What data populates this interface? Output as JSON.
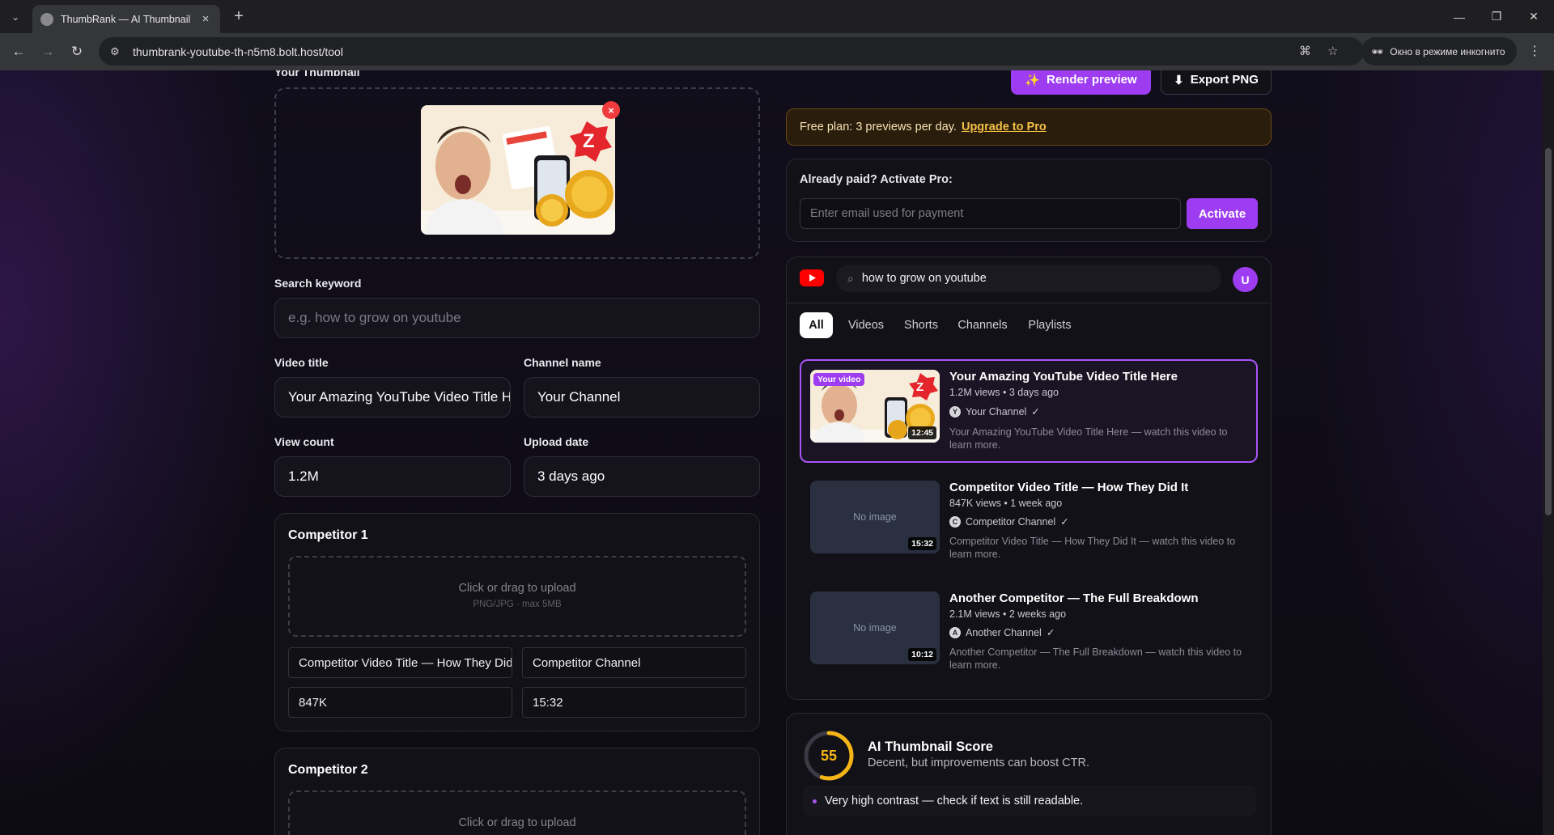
{
  "browser": {
    "tab_title": "ThumbRank — AI Thumbnail Pr",
    "url": "thumbrank-youtube-th-n5m8.bolt.host/tool",
    "incognito_label": "Окно в режиме инкогнито"
  },
  "left": {
    "thumbnail_label": "Your Thumbnail",
    "search_keyword": {
      "label": "Search keyword",
      "placeholder": "e.g. how to grow on youtube"
    },
    "video_title": {
      "label": "Video title",
      "value": "Your Amazing YouTube Video Title Here"
    },
    "channel_name": {
      "label": "Channel name",
      "value": "Your Channel"
    },
    "view_count": {
      "label": "View count",
      "value": "1.2M"
    },
    "upload_date": {
      "label": "Upload date",
      "value": "3 days ago"
    },
    "competitor1": {
      "heading": "Competitor 1",
      "upload_text": "Click or drag to upload",
      "upload_hint": "PNG/JPG · max 5MB",
      "title": "Competitor Video Title — How They Did It",
      "channel": "Competitor Channel",
      "views": "847K",
      "duration": "15:32"
    },
    "competitor2": {
      "heading": "Competitor 2",
      "upload_text": "Click or drag to upload"
    }
  },
  "right": {
    "render_label": "Render preview",
    "export_label": "Export PNG",
    "free_plan_text": "Free plan: 3 previews per day.",
    "upgrade_link": "Upgrade to Pro",
    "activate": {
      "heading": "Already paid? Activate Pro:",
      "placeholder": "Enter email used for payment",
      "button": "Activate"
    },
    "yt": {
      "search_query": "how to grow on youtube",
      "avatar_letter": "U",
      "chips": [
        "All",
        "Videos",
        "Shorts",
        "Channels",
        "Playlists"
      ],
      "results": [
        {
          "badge": "Your video",
          "title": "Your Amazing YouTube Video Title Here",
          "meta": "1.2M views • 3 days ago",
          "channel": "Your Channel",
          "channel_initial": "Y",
          "desc": "Your Amazing YouTube Video Title Here — watch this video to learn more.",
          "duration": "12:45"
        },
        {
          "no_image": "No image",
          "title": "Competitor Video Title — How They Did It",
          "meta": "847K views • 1 week ago",
          "channel": "Competitor Channel",
          "channel_initial": "C",
          "desc": "Competitor Video Title — How They Did It — watch this video to learn more.",
          "duration": "15:32"
        },
        {
          "no_image": "No image",
          "title": "Another Competitor — The Full Breakdown",
          "meta": "2.1M views • 2 weeks ago",
          "channel": "Another Channel",
          "channel_initial": "A",
          "desc": "Another Competitor — The Full Breakdown — watch this video to learn more.",
          "duration": "10:12"
        }
      ]
    },
    "score": {
      "value": "55",
      "fraction": 0.55,
      "title": "AI Thumbnail Score",
      "subtitle": "Decent, but improvements can boost CTR.",
      "tip": "Very high contrast — check if text is still readable."
    }
  },
  "colors": {
    "accent": "#9d3cf0",
    "score_ring": "#f5b516",
    "youtube_red": "#ff0000",
    "warning_bg": "#2a1d0c",
    "warning_link": "#f5c146"
  }
}
